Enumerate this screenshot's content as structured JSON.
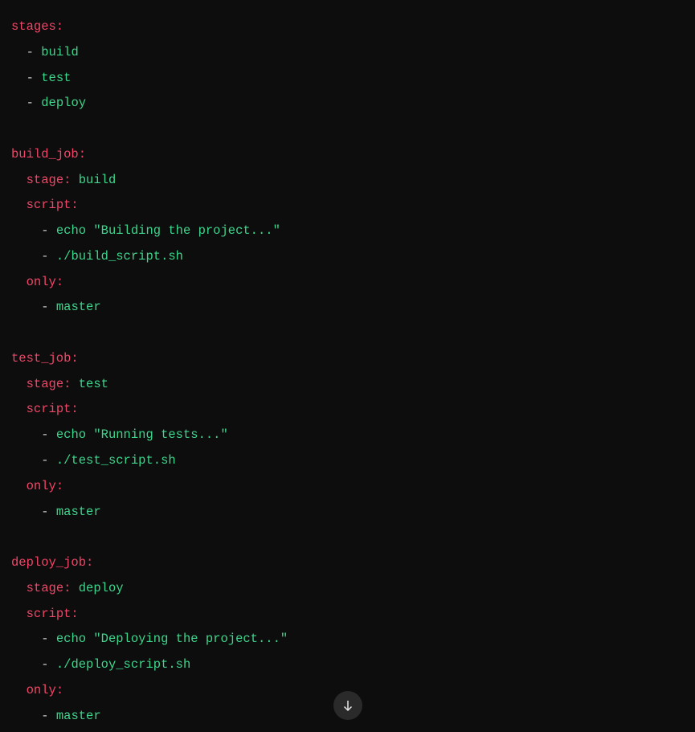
{
  "yaml": {
    "stages_key": "stages:",
    "stages": [
      "build",
      "test",
      "deploy"
    ],
    "jobs": [
      {
        "name_key": "build_job:",
        "stage_key": "stage:",
        "stage_value": "build",
        "script_key": "script:",
        "script_lines": [
          "echo \"Building the project...\"",
          "./build_script.sh"
        ],
        "only_key": "only:",
        "only_values": [
          "master"
        ]
      },
      {
        "name_key": "test_job:",
        "stage_key": "stage:",
        "stage_value": "test",
        "script_key": "script:",
        "script_lines": [
          "echo \"Running tests...\"",
          "./test_script.sh"
        ],
        "only_key": "only:",
        "only_values": [
          "master"
        ]
      },
      {
        "name_key": "deploy_job:",
        "stage_key": "stage:",
        "stage_value": "deploy",
        "script_key": "script:",
        "script_lines": [
          "echo \"Deploying the project...\"",
          "./deploy_script.sh"
        ],
        "only_key": "only:",
        "only_values": [
          "master"
        ]
      }
    ]
  }
}
